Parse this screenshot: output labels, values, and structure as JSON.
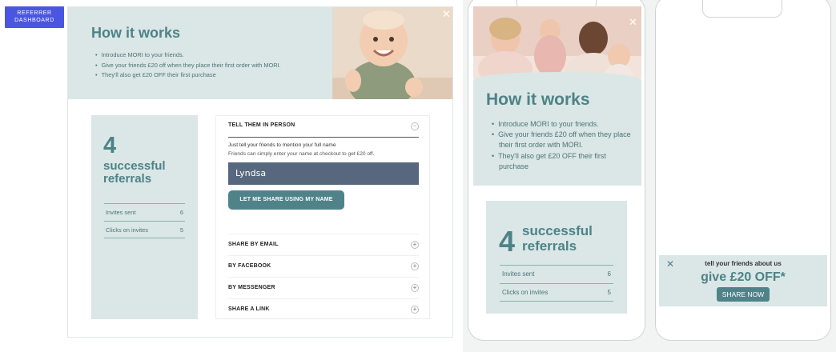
{
  "badge": {
    "label": "REFERRER DASHBOARD",
    "color": "#4a56e2"
  },
  "desktop": {
    "hero": {
      "title": "How it works",
      "steps": [
        "Introduce MORI to your friends.",
        "Give your friends £20 off when they place their first order with MORI.",
        "They'll also get £20 OFF their first purchase"
      ],
      "close_glyph": "✕"
    },
    "stats": {
      "count": "4",
      "label": "successful referrals",
      "rows": [
        {
          "label": "Invites sent",
          "value": "6"
        },
        {
          "label": "Clicks on invites",
          "value": "5"
        }
      ]
    },
    "share": {
      "active_title": "TELL THEM IN PERSON",
      "collapse_glyph": "−",
      "instruction": "Just tell your friends to mention your full name",
      "subtext": "Friends can simply enter your name at checkout to get £20 off.",
      "name_value": "Lyndsa",
      "cta_label": "LET ME SHARE USING MY NAME",
      "options": [
        {
          "label": "SHARE BY EMAIL",
          "glyph": "+"
        },
        {
          "label": "BY FACEBOOK",
          "glyph": "+"
        },
        {
          "label": "BY MESSENGER",
          "glyph": "+"
        },
        {
          "label": "SHARE A LINK",
          "glyph": "+"
        }
      ]
    }
  },
  "mobile": {
    "close_glyph": "✕",
    "title": "How it works",
    "steps": [
      "Introduce MORI to your friends.",
      "Give your friends £20 off when they place their first order with MORI.",
      "They'll also get £20 OFF their first purchase"
    ],
    "stats": {
      "count": "4",
      "label": "successful referrals",
      "rows": [
        {
          "label": "Invites sent",
          "value": "6"
        },
        {
          "label": "Clicks on invites",
          "value": "5"
        }
      ]
    }
  },
  "mobile_banner": {
    "close_glyph": "✕",
    "line1": "tell your friends about us",
    "headline": "give £20 OFF*",
    "button": "SHARE NOW"
  },
  "colors": {
    "accent": "#4d8287",
    "panel": "#dae7e6",
    "button": "#4f8389",
    "name_box": "#57687e"
  }
}
